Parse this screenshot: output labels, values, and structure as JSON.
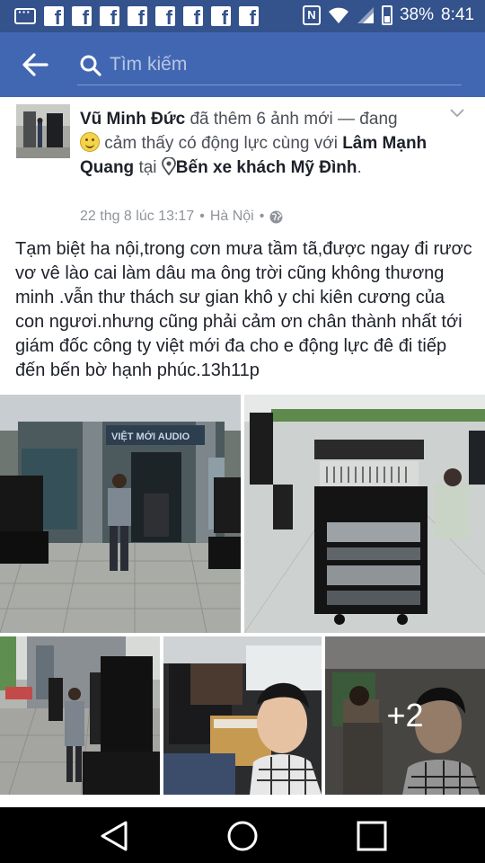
{
  "status_bar": {
    "battery": "38%",
    "time": "8:41",
    "nfc": "N",
    "notification_icons": [
      "message-icon",
      "facebook-icon",
      "facebook-icon",
      "facebook-icon",
      "facebook-icon",
      "facebook-icon",
      "facebook-icon",
      "facebook-icon",
      "facebook-icon"
    ]
  },
  "top_nav": {
    "search_placeholder": "Tìm kiếm",
    "colors": {
      "bar": "#4267b2",
      "status": "#34528c"
    }
  },
  "post": {
    "author": "Vũ Minh Đức",
    "action_1": " đã thêm 6 ảnh mới — đang ",
    "action_2": " cảm thấy có động lực cùng với ",
    "tagged": "Lâm Mạnh Quang",
    "at": " tại ",
    "place": "Bến xe khách Mỹ Đình",
    "period": ".",
    "timestamp": "22 thg 8 lúc 13:17",
    "location": "Hà Nội",
    "separator": "•",
    "privacy_icon": "globe-icon",
    "text": "Tạm biệt ha nội,trong cơn mưa tầm tã,được ngay đi rươc vơ vê lào cai làm dâu ma ông trời cũng không thương minh .vẫn thư thách sư gian khô y chi kiên cương của con ngươi.nhưng cũng phải cảm ơn chân thành nhất tới giám đốc công ty việt mới đa cho e động lực đê đi tiếp đến bến bờ hạnh phúc.13h11p",
    "photos_more": "+2",
    "store_sign": "VIỆT MỚI AUDIO"
  },
  "android_nav": {
    "back": "back-triangle-icon",
    "home": "home-circle-icon",
    "recents": "recents-square-icon"
  }
}
